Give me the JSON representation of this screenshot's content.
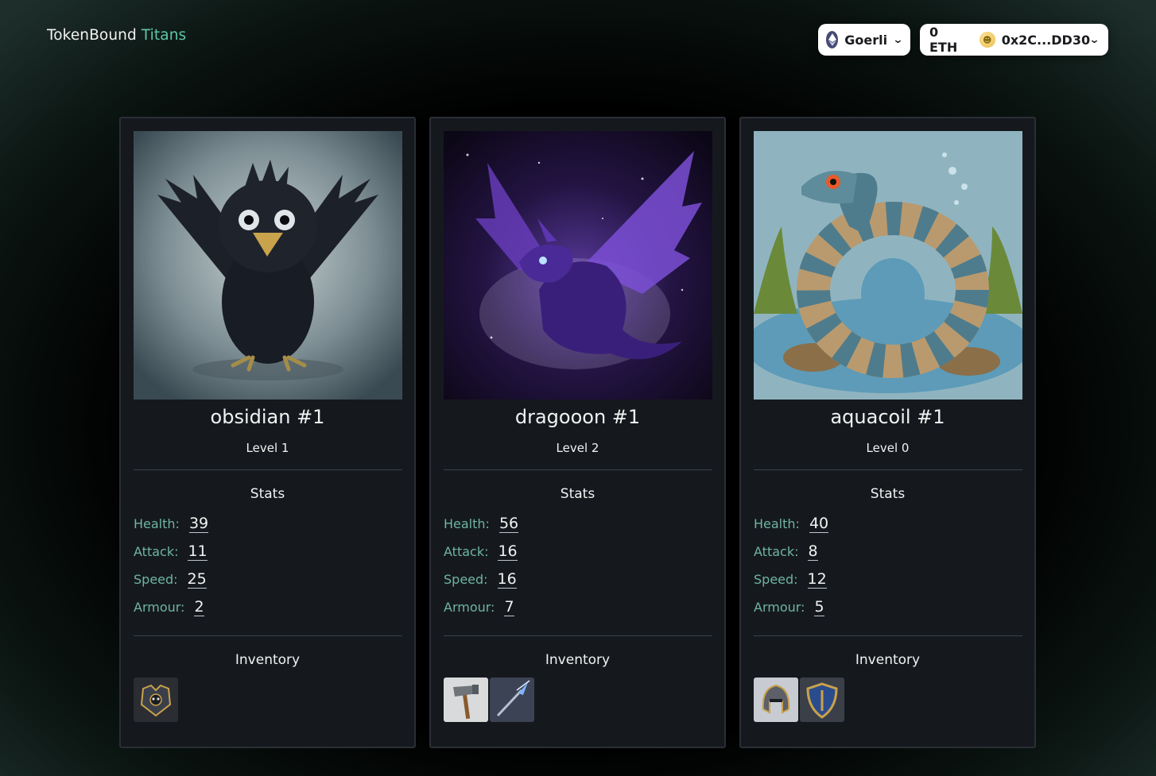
{
  "header": {
    "logo_main": "TokenBound",
    "logo_accent": "Titans",
    "network_label": "Goerli",
    "balance": "0 ETH",
    "address": "0x2C...DD30"
  },
  "sections": {
    "stats": "Stats",
    "inventory": "Inventory"
  },
  "stat_labels": {
    "health": "Health:",
    "attack": "Attack:",
    "speed": "Speed:",
    "armour": "Armour:"
  },
  "cards": [
    {
      "name": "obsidian #1",
      "level": "Level 1",
      "health": "39",
      "attack": "11",
      "speed": "25",
      "armour": "2",
      "art": "raven-creature",
      "inventory": [
        "chest-armour-icon"
      ]
    },
    {
      "name": "dragooon #1",
      "level": "Level 2",
      "health": "56",
      "attack": "16",
      "speed": "16",
      "armour": "7",
      "art": "purple-dragon",
      "inventory": [
        "hammer-icon",
        "spear-icon"
      ]
    },
    {
      "name": "aquacoil #1",
      "level": "Level 0",
      "health": "40",
      "attack": "8",
      "speed": "12",
      "armour": "5",
      "art": "water-serpent",
      "inventory": [
        "helmet-icon",
        "shield-icon"
      ]
    }
  ]
}
